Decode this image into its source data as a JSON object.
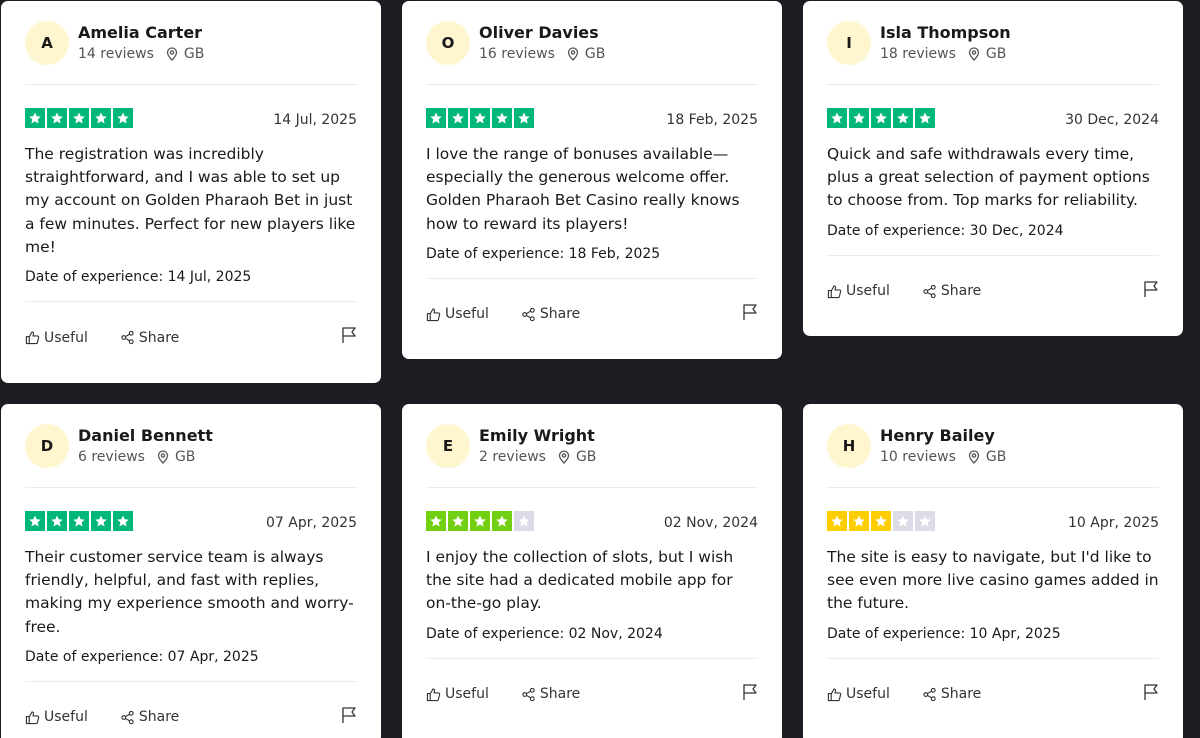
{
  "colors": {
    "page_background": "#1c1c22",
    "star_green": "#00b67a",
    "star_lightgreen": "#73cf11",
    "star_yellow": "#ffce00",
    "star_empty": "#dcdce6",
    "avatar_bg": "#fff6cf"
  },
  "labels": {
    "useful": "Useful",
    "share": "Share",
    "experience_prefix": "Date of experience: "
  },
  "icons": [
    "thumbs-up-icon",
    "share-icon",
    "flag-icon",
    "location-pin-icon",
    "star-icon"
  ],
  "reviews": [
    {
      "initial": "A",
      "name": "Amelia Carter",
      "reviews_count": "14 reviews",
      "country": "GB",
      "rating": 5,
      "date": "14 Jul, 2025",
      "text": "The registration was incredibly straightforward, and I was able to set up my account on Golden Pharaoh Bet in just a few minutes. Perfect for new players like me!",
      "experience_date": "14 Jul, 2025"
    },
    {
      "initial": "O",
      "name": "Oliver Davies",
      "reviews_count": "16 reviews",
      "country": "GB",
      "rating": 5,
      "date": "18 Feb, 2025",
      "text": "I love the range of bonuses available—especially the generous welcome offer. Golden Pharaoh Bet Casino really knows how to reward its players!",
      "experience_date": "18 Feb, 2025"
    },
    {
      "initial": "I",
      "name": "Isla Thompson",
      "reviews_count": "18 reviews",
      "country": "GB",
      "rating": 5,
      "date": "30 Dec, 2024",
      "text": "Quick and safe withdrawals every time, plus a great selection of payment options to choose from. Top marks for reliability.",
      "experience_date": "30 Dec, 2024"
    },
    {
      "initial": "D",
      "name": "Daniel Bennett",
      "reviews_count": "6 reviews",
      "country": "GB",
      "rating": 5,
      "date": "07 Apr, 2025",
      "text": "Their customer service team is always friendly, helpful, and fast with replies, making my experience smooth and worry-free.",
      "experience_date": "07 Apr, 2025"
    },
    {
      "initial": "E",
      "name": "Emily Wright",
      "reviews_count": "2 reviews",
      "country": "GB",
      "rating": 4,
      "date": "02 Nov, 2024",
      "text": "I enjoy the collection of slots, but I wish the site had a dedicated mobile app for on-the-go play.",
      "experience_date": "02 Nov, 2024"
    },
    {
      "initial": "H",
      "name": "Henry Bailey",
      "reviews_count": "10 reviews",
      "country": "GB",
      "rating": 3,
      "date": "10 Apr, 2025",
      "text": "The site is easy to navigate, but I'd like to see even more live casino games added in the future.",
      "experience_date": "10 Apr, 2025"
    }
  ]
}
